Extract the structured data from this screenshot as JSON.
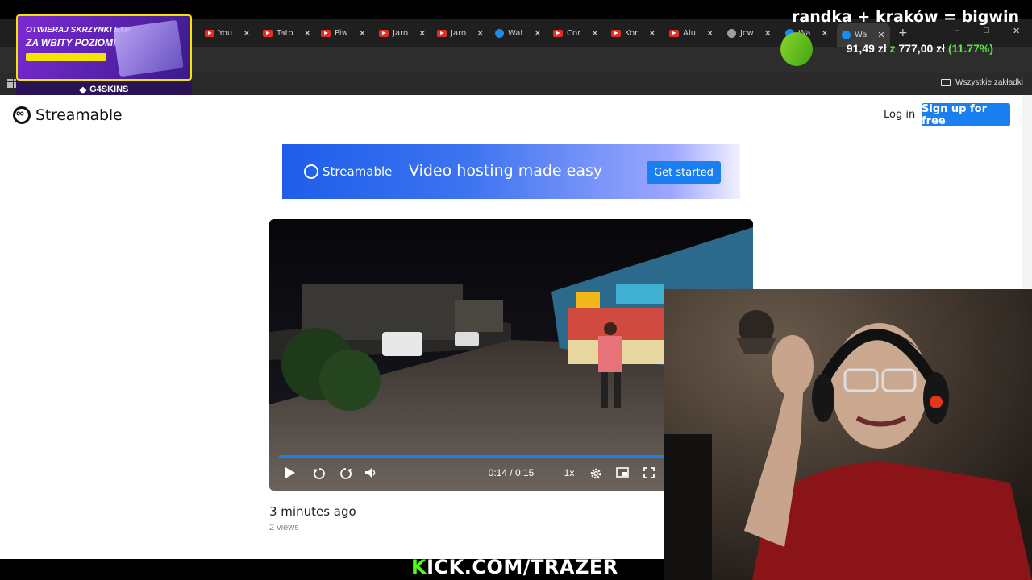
{
  "browser": {
    "tabs": [
      {
        "label": "You",
        "icon": "youtube-icon"
      },
      {
        "label": "Tato",
        "icon": "youtube-icon"
      },
      {
        "label": "Piw",
        "icon": "youtube-icon"
      },
      {
        "label": "Jaro",
        "icon": "youtube-icon"
      },
      {
        "label": "Jaro",
        "icon": "youtube-icon"
      },
      {
        "label": "Wat",
        "icon": "streamable-icon"
      },
      {
        "label": "Cor",
        "icon": "youtube-icon"
      },
      {
        "label": "Kor",
        "icon": "youtube-icon"
      },
      {
        "label": "Alu",
        "icon": "youtube-icon"
      },
      {
        "label": "Jcw",
        "icon": "globe-icon"
      },
      {
        "label": "Wa",
        "icon": "streamable-icon"
      },
      {
        "label": "Wa",
        "icon": "streamable-icon"
      }
    ],
    "new_tab": "+",
    "window_min": "–",
    "window_max": "□",
    "window_close": "✕",
    "all_bookmarks": "Wszystkie zakładki"
  },
  "ad": {
    "line1": "OTWIERAJ SKRZYNKI EXP",
    "line2": "ZA WBITY POZIOM!",
    "brand": "G4SKINS"
  },
  "stream": {
    "title": "randka + kraków = bigwin",
    "money_current": "91,49 zł",
    "money_sep": "z",
    "money_target": "777,00 zł",
    "money_pct": "(11.77%)",
    "kick_prefix": "K",
    "kick_rest": "ICK.COM/TRAZER"
  },
  "site": {
    "brand": "Streamable",
    "login": "Log in",
    "signup": "Sign up for free",
    "banner": {
      "brand": "Streamable",
      "tagline": "Video hosting made easy",
      "cta": "Get started"
    },
    "player": {
      "time": "0:14 / 0:15",
      "speed": "1x",
      "progress": 0.93
    },
    "uploaded": "3 minutes ago",
    "views": "2 views"
  },
  "colors": {
    "accent": "#1a7ff0",
    "kick_green": "#53fc18",
    "money_green": "#62e24a"
  }
}
